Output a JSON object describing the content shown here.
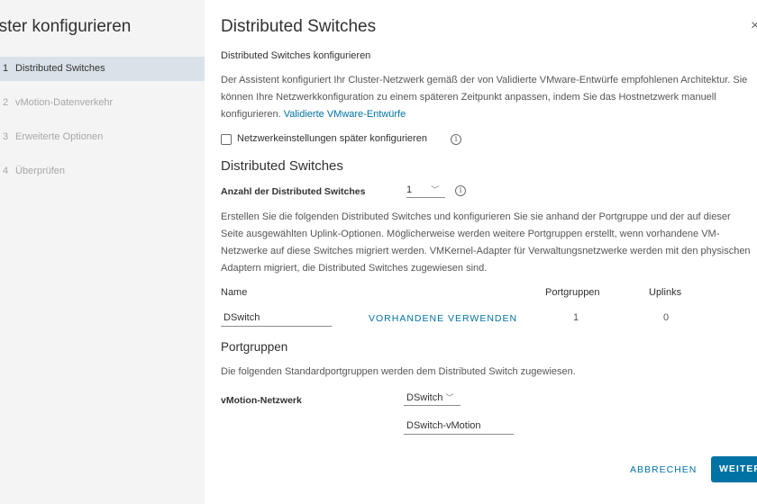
{
  "sidebar": {
    "title": "uster konfigurieren",
    "steps": [
      {
        "num": "1",
        "label": "Distributed Switches"
      },
      {
        "num": "2",
        "label": "vMotion-Datenverkehr"
      },
      {
        "num": "3",
        "label": "Erweiterte Optionen"
      },
      {
        "num": "4",
        "label": "Überprüfen"
      }
    ]
  },
  "main": {
    "title": "Distributed Switches",
    "close_glyph": "×",
    "subtitle": "Distributed Switches konfigurieren",
    "intro_text": "Der Assistent konfiguriert Ihr Cluster-Netzwerk gemäß der von Validierte VMware-Entwürfe empfohlenen Architektur. Sie können Ihre Netzwerkkonfiguration zu einem späteren Zeitpunkt anpassen, indem Sie das Hostnetzwerk manuell konfigurieren.",
    "intro_link": "Validierte VMware-Entwürfe",
    "later_checkbox_label": "Netzwerkeinstellungen später konfigurieren",
    "section_switches": "Distributed Switches",
    "count_label": "Anzahl der Distributed Switches",
    "count_value": "1",
    "switches_text": "Erstellen Sie die folgenden Distributed Switches und konfigurieren Sie sie anhand der Portgruppe und der auf dieser Seite ausgewählten Uplink-Optionen. Möglicherweise werden weitere Portgruppen erstellt, wenn vorhandene VM-Netzwerke auf diese Switches migriert werden. VMKernel-Adapter für Verwaltungsnetzwerke werden mit den physischen Adaptern migriert, die Distributed Switches zugewiesen sind.",
    "table": {
      "headers": {
        "name": "Name",
        "portgroups": "Portgruppen",
        "uplinks": "Uplinks"
      },
      "row": {
        "name": "DSwitch",
        "use_existing": "VORHANDENE VERWENDEN",
        "portgroups": "1",
        "uplinks": "0"
      }
    },
    "section_portgroups": "Portgruppen",
    "portgroups_text": "Die folgenden Standardportgruppen werden dem Distributed Switch zugewiesen.",
    "vmotion_label": "vMotion-Netzwerk",
    "vmotion_switch": "DSwitch",
    "vmotion_portgroup": "DSwitch-vMotion"
  },
  "footer": {
    "cancel": "ABBRECHEN",
    "next": "WEITER"
  },
  "icons": {
    "info": "info-icon",
    "chevron": "chevron-down-icon",
    "close": "close-icon"
  },
  "colors": {
    "accent": "#0072a3",
    "sidebar_bg": "#f4f4f4",
    "active_step_bg": "#d9e2e9"
  }
}
